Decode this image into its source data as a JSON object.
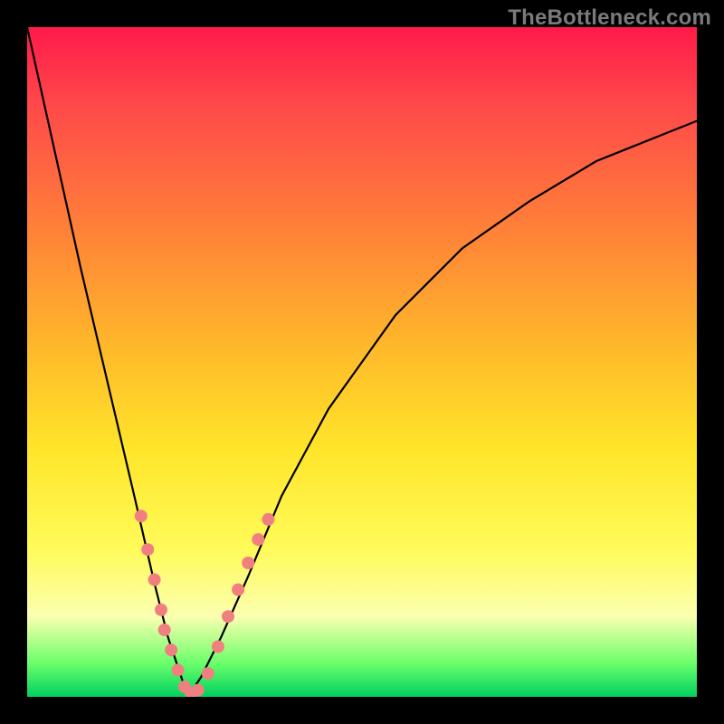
{
  "watermark": "TheBottleneck.com",
  "chart_data": {
    "type": "line",
    "title": "",
    "xlabel": "",
    "ylabel": "",
    "xlim": [
      0,
      1
    ],
    "ylim": [
      0,
      1
    ],
    "grid": false,
    "legend": false,
    "notes": "V-shaped bottleneck curve rendered over a vertical rainbow gradient (red at top through yellow to green at bottom). Curve minimum is at roughly x≈0.24 where it touches the bottom (y≈0). Axes are unlabeled black borders.",
    "series": [
      {
        "name": "left-branch",
        "x": [
          0.0,
          0.04,
          0.08,
          0.12,
          0.16,
          0.19,
          0.21,
          0.23,
          0.24
        ],
        "y": [
          1.0,
          0.82,
          0.64,
          0.47,
          0.3,
          0.17,
          0.09,
          0.03,
          0.0
        ]
      },
      {
        "name": "right-branch",
        "x": [
          0.24,
          0.26,
          0.29,
          0.33,
          0.38,
          0.45,
          0.55,
          0.65,
          0.75,
          0.85,
          0.95,
          1.0
        ],
        "y": [
          0.0,
          0.03,
          0.09,
          0.18,
          0.3,
          0.43,
          0.57,
          0.67,
          0.74,
          0.8,
          0.84,
          0.86
        ]
      }
    ],
    "scatter": {
      "name": "highlight-dots",
      "color": "#f08080",
      "points": [
        {
          "x": 0.17,
          "y": 0.27
        },
        {
          "x": 0.18,
          "y": 0.22
        },
        {
          "x": 0.19,
          "y": 0.175
        },
        {
          "x": 0.2,
          "y": 0.13
        },
        {
          "x": 0.205,
          "y": 0.1
        },
        {
          "x": 0.215,
          "y": 0.07
        },
        {
          "x": 0.225,
          "y": 0.04
        },
        {
          "x": 0.235,
          "y": 0.015
        },
        {
          "x": 0.245,
          "y": 0.005
        },
        {
          "x": 0.255,
          "y": 0.01
        },
        {
          "x": 0.27,
          "y": 0.035
        },
        {
          "x": 0.285,
          "y": 0.075
        },
        {
          "x": 0.3,
          "y": 0.12
        },
        {
          "x": 0.315,
          "y": 0.16
        },
        {
          "x": 0.33,
          "y": 0.2
        },
        {
          "x": 0.345,
          "y": 0.235
        },
        {
          "x": 0.36,
          "y": 0.265
        }
      ]
    }
  }
}
